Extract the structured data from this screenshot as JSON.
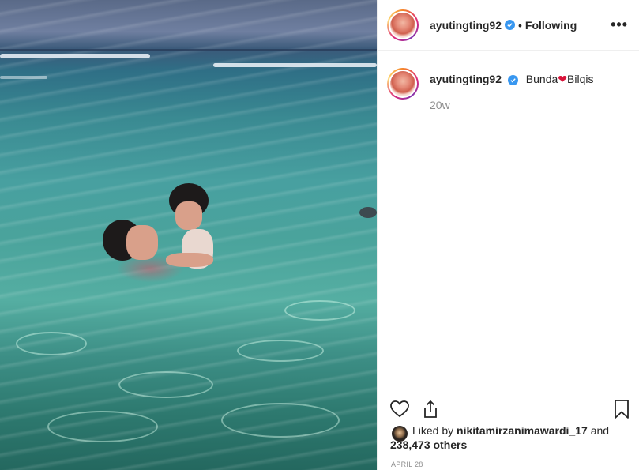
{
  "post": {
    "username": "ayutingting92",
    "follow_status": "Following",
    "separator": "•",
    "more_label": "•••"
  },
  "caption": {
    "username": "ayutingting92",
    "text_before": "Bunda",
    "heart": "❤",
    "text_after": "Bilqis",
    "time_ago": "20w"
  },
  "actions": {
    "like_icon": "heart-outline-icon",
    "share_icon": "share-icon",
    "save_icon": "bookmark-icon"
  },
  "likes": {
    "prefix": "Liked by",
    "liker": "nikitamirzanimawardi_17",
    "conjunction": "and",
    "count": "238,473 others"
  },
  "date": "APRIL 28",
  "colors": {
    "verified": "#3897f0",
    "heart": "#d9143a",
    "muted": "#8e8e8e",
    "text": "#262626"
  }
}
